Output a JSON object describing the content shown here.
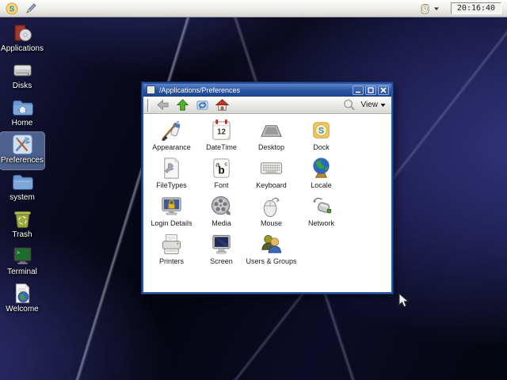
{
  "menubar": {
    "clock_label": "20:16:40"
  },
  "desktop": {
    "icons": [
      {
        "label": "Applications"
      },
      {
        "label": "Disks"
      },
      {
        "label": "Home"
      },
      {
        "label": "Preferences",
        "selected": true
      },
      {
        "label": "system"
      },
      {
        "label": "Trash"
      },
      {
        "label": "Terminal"
      },
      {
        "label": "Welcome"
      }
    ]
  },
  "window": {
    "title": "/Applications/Preferences",
    "toolbar": {
      "view_label": "View"
    },
    "grid": [
      {
        "label": "Appearance"
      },
      {
        "label": "DateTime"
      },
      {
        "label": "Desktop"
      },
      {
        "label": "Dock"
      },
      {
        "label": "FileTypes"
      },
      {
        "label": "Font"
      },
      {
        "label": "Keyboard"
      },
      {
        "label": "Locale"
      },
      {
        "label": "Login Details"
      },
      {
        "label": "Media"
      },
      {
        "label": "Mouse"
      },
      {
        "label": "Network"
      },
      {
        "label": "Printers"
      },
      {
        "label": "Screen"
      },
      {
        "label": "Users & Groups"
      }
    ]
  },
  "icon_glyphs": {
    "logo_letter": "S",
    "calendar_day": "12",
    "font_a": "a",
    "font_b": "b",
    "font_c": "c",
    "terminal_prompt": ">"
  },
  "colors": {
    "titlebar": "#2b56a2",
    "selection": "#80a4de",
    "desktop_base": "#05050e"
  }
}
